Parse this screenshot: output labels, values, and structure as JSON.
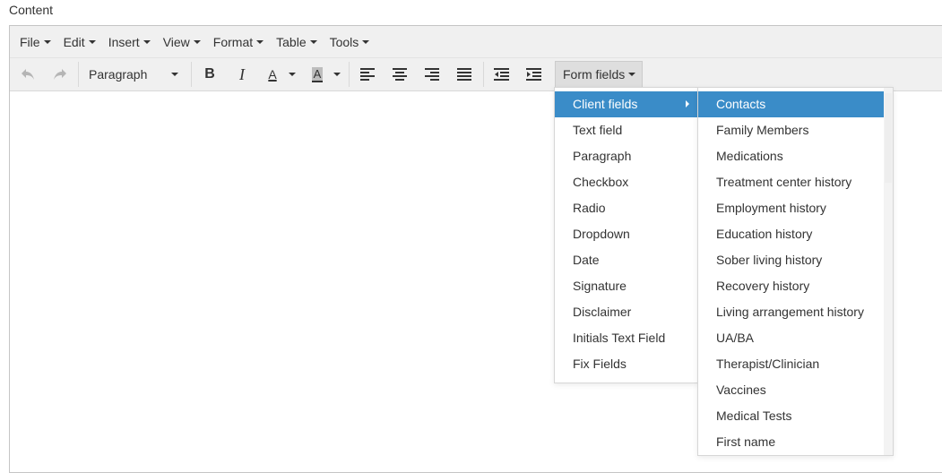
{
  "field_label": "Content",
  "menubar": {
    "items": [
      "File",
      "Edit",
      "Insert",
      "View",
      "Format",
      "Table",
      "Tools"
    ]
  },
  "toolbar": {
    "block_format": "Paragraph",
    "form_fields_label": "Form fields",
    "bold_glyph": "B",
    "italic_glyph": "I",
    "text_color_glyph": "A",
    "bg_color_glyph": "A"
  },
  "form_fields_menu": {
    "items": [
      "Client fields",
      "Text field",
      "Paragraph",
      "Checkbox",
      "Radio",
      "Dropdown",
      "Date",
      "Signature",
      "Disclaimer",
      "Initials Text Field",
      "Fix Fields"
    ],
    "active_index": 0
  },
  "client_fields_submenu": {
    "items": [
      "Contacts",
      "Family Members",
      "Medications",
      "Treatment center history",
      "Employment history",
      "Education history",
      "Sober living history",
      "Recovery history",
      "Living arrangement history",
      "UA/BA",
      "Therapist/Clinician",
      "Vaccines",
      "Medical Tests",
      "First name"
    ],
    "active_index": 0
  },
  "colors": {
    "active_item": "#3a8cc8",
    "toolbar_bg": "#f0f0f0",
    "border": "#c5c5c5",
    "text": "#333333"
  }
}
